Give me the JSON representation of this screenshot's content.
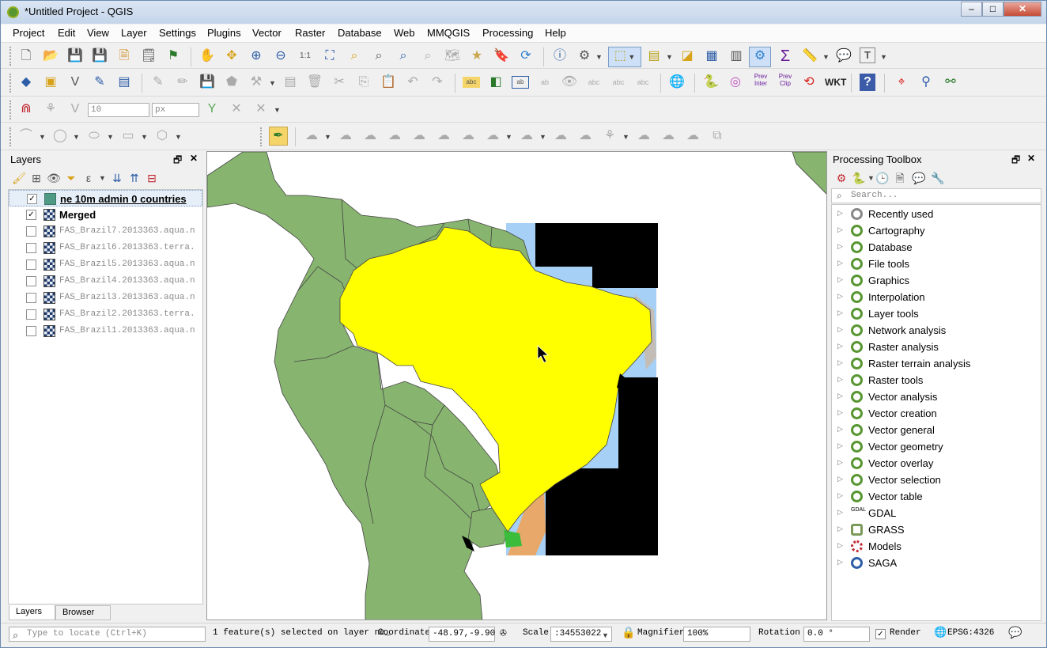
{
  "window": {
    "title": "*Untitled Project - QGIS"
  },
  "menubar": [
    "Project",
    "Edit",
    "View",
    "Layer",
    "Settings",
    "Plugins",
    "Vector",
    "Raster",
    "Database",
    "Web",
    "MMQGIS",
    "Processing",
    "Help"
  ],
  "toolbars": {
    "icon_labels": {
      "prev_inter": "Prev Inter",
      "prev_clip": "Prev Clip",
      "wkt": "WKT"
    },
    "snapping": {
      "tolerance": "10",
      "unit": "px"
    }
  },
  "layers_panel": {
    "title": "Layers",
    "layers": [
      {
        "name": "ne 10m admin 0 countries",
        "checked": true,
        "type": "vector"
      },
      {
        "name": "Merged",
        "checked": true,
        "type": "raster"
      },
      {
        "name": "FAS_Brazil7.2013363.aqua.n",
        "checked": false,
        "type": "raster"
      },
      {
        "name": "FAS_Brazil6.2013363.terra.",
        "checked": false,
        "type": "raster"
      },
      {
        "name": "FAS_Brazil5.2013363.aqua.n",
        "checked": false,
        "type": "raster"
      },
      {
        "name": "FAS_Brazil4.2013363.aqua.n",
        "checked": false,
        "type": "raster"
      },
      {
        "name": "FAS_Brazil3.2013363.aqua.n",
        "checked": false,
        "type": "raster"
      },
      {
        "name": "FAS_Brazil2.2013363.terra.",
        "checked": false,
        "type": "raster"
      },
      {
        "name": "FAS_Brazil1.2013363.aqua.n",
        "checked": false,
        "type": "raster"
      }
    ],
    "tabs": [
      "Layers",
      "Browser"
    ]
  },
  "processing": {
    "title": "Processing Toolbox",
    "search_placeholder": "Search...",
    "items": [
      "Recently used",
      "Cartography",
      "Database",
      "File tools",
      "Graphics",
      "Interpolation",
      "Layer tools",
      "Network analysis",
      "Raster analysis",
      "Raster terrain analysis",
      "Raster tools",
      "Vector analysis",
      "Vector creation",
      "Vector general",
      "Vector geometry",
      "Vector overlay",
      "Vector selection",
      "Vector table",
      "GDAL",
      "GRASS",
      "Models",
      "SAGA"
    ]
  },
  "status": {
    "locate_placeholder": "Type to locate (Ctrl+K)",
    "message": "1 feature(s) selected on layer ne_",
    "coordinate_label": "Coordinate",
    "coordinate": "-48.97,-9.90",
    "scale_label": "Scale",
    "scale": ":34553022",
    "magnifier_label": "Magnifier",
    "magnifier": "100%",
    "rotation_label": "Rotation",
    "rotation": "0.0 °",
    "render_label": "Render",
    "crs": "EPSG:4326"
  },
  "colors": {
    "countries": "#87b46f",
    "brazil_selected": "#ffff00",
    "ocean_raster": "#a6d0f5",
    "nodata": "#000000"
  }
}
